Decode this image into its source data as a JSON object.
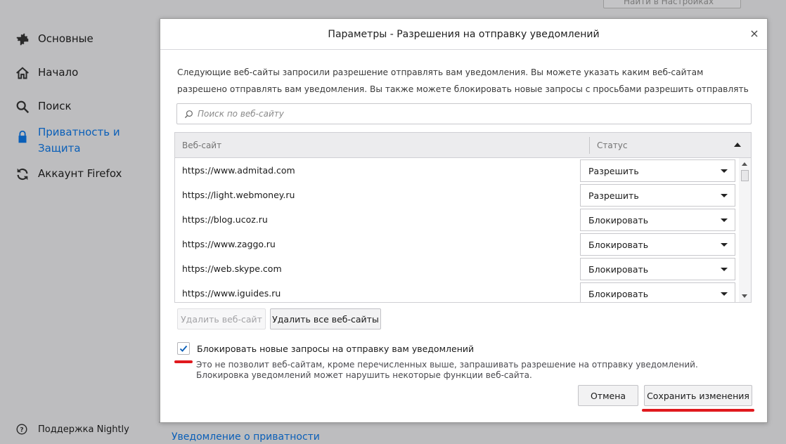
{
  "background": {
    "search_placeholder": "Найти в Настройках",
    "sidebar": {
      "items": [
        {
          "label": "Основные",
          "icon": "gear-icon"
        },
        {
          "label": "Начало",
          "icon": "home-icon"
        },
        {
          "label": "Поиск",
          "icon": "search-icon"
        },
        {
          "label": "Приватность и Защита",
          "icon": "lock-icon",
          "active": true
        },
        {
          "label": "Аккаунт Firefox",
          "icon": "sync-icon"
        }
      ],
      "support_label": "Поддержка Nightly"
    },
    "privacy_link": "Уведомление о приватности"
  },
  "dialog": {
    "title": "Параметры - Разрешения на отправку уведомлений",
    "close_glyph": "×",
    "description": "Следующие веб-сайты запросили разрешение отправлять вам уведомления. Вы можете указать каким веб-сайтам разрешено отправлять вам уведомления. Вы также можете блокировать новые запросы с просьбами разрешить отправлять вам уведомления.",
    "search_placeholder": "Поиск по веб-сайту",
    "table": {
      "col_site": "Веб-сайт",
      "col_status": "Статус",
      "rows": [
        {
          "site": "https://www.admitad.com",
          "status": "Разрешить"
        },
        {
          "site": "https://light.webmoney.ru",
          "status": "Разрешить"
        },
        {
          "site": "https://blog.ucoz.ru",
          "status": "Блокировать"
        },
        {
          "site": "https://www.zaggo.ru",
          "status": "Блокировать"
        },
        {
          "site": "https://web.skype.com",
          "status": "Блокировать"
        },
        {
          "site": "https://www.iguides.ru",
          "status": "Блокировать"
        }
      ]
    },
    "remove_site_label": "Удалить веб-сайт",
    "remove_all_label": "Удалить все веб-сайты",
    "block_checkbox_label": "Блокировать новые запросы на отправку вам уведомлений",
    "block_checkbox_checked": true,
    "block_description": "Это не позволит веб-сайтам, кроме перечисленных выше, запрашивать разрешение на отправку уведомлений. Блокировка уведомлений может нарушить некоторые функции веб-сайта.",
    "cancel_label": "Отмена",
    "save_label": "Сохранить изменения"
  },
  "colors": {
    "accent": "#0a5fb8",
    "highlight": "#e0191e",
    "backdrop": "#bdbdbf"
  }
}
